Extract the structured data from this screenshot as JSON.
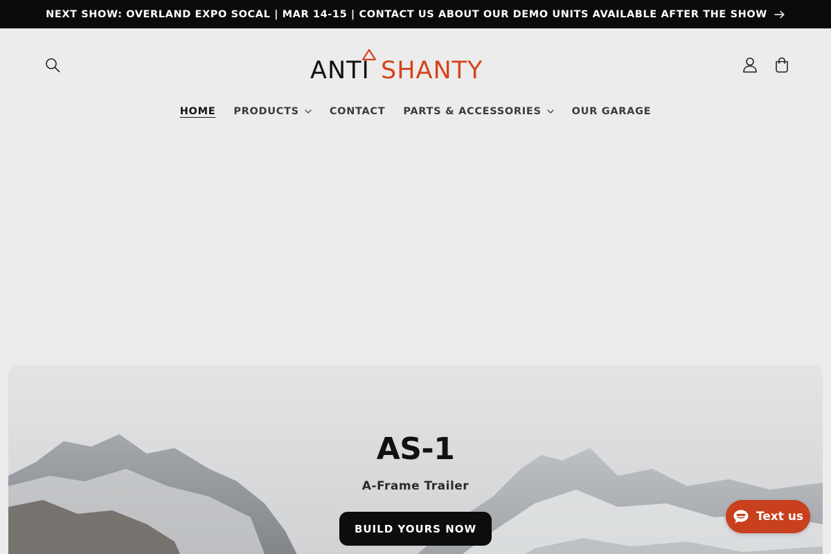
{
  "announcement": {
    "text": "NEXT SHOW: OVERLAND EXPO SOCAL | MAR 14-15 | CONTACT US ABOUT OUR DEMO UNITS AVAILABLE AFTER THE SHOW",
    "icon": "arrow-right-icon"
  },
  "header": {
    "logo": {
      "part1": "ANTI",
      "part2": "SHANTY",
      "accent_color": "#d4441c"
    },
    "icons": [
      "search-icon",
      "account-icon",
      "cart-icon"
    ]
  },
  "nav": {
    "items": [
      {
        "label": "HOME",
        "active": true,
        "has_dropdown": false
      },
      {
        "label": "PRODUCTS",
        "active": false,
        "has_dropdown": true
      },
      {
        "label": "CONTACT",
        "active": false,
        "has_dropdown": false
      },
      {
        "label": "PARTS & ACCESSORIES",
        "active": false,
        "has_dropdown": true
      },
      {
        "label": "OUR GARAGE",
        "active": false,
        "has_dropdown": false
      }
    ]
  },
  "hero": {
    "title": "AS-1",
    "subtitle": "A-Frame Trailer",
    "cta_label": "BUILD YOURS NOW"
  },
  "chat": {
    "label": "Text us",
    "icon": "chat-bubble-icon",
    "color": "#c8401d"
  }
}
